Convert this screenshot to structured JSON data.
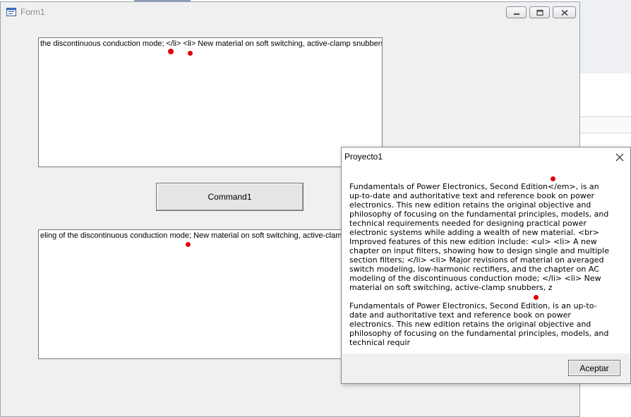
{
  "main_window": {
    "title": "Form1",
    "minimize_glyph": "minimize-icon",
    "maximize_glyph": "maximize-icon",
    "close_glyph": "close-icon"
  },
  "text1": {
    "value": "the discontinuous conduction mode; </li> <li> New material on soft switching, active-clamp snubbers, z"
  },
  "command1": {
    "label": "Command1"
  },
  "text2": {
    "value": "eling of the discontinuous conduction mode;   New material on soft switching, active-clamp snubbers, z"
  },
  "msgbox": {
    "title": "Proyecto1",
    "paragraph1": "Fundamentals of Power Electronics, Second Edition</em>, is an up-to-date and authoritative text and reference book on power electronics. This new edition retains the original objective and philosophy of focusing on the fundamental principles, models, and technical requirements needed for designing practical power electronic systems while adding a wealth of new material. <br> Improved features of this new edition include: <ul> <li> A new chapter on input filters, showing how to design single and multiple section filters; </li> <li> Major revisions of material on averaged switch modeling, low-harmonic rectifiers, and the chapter on AC modeling of the discontinuous conduction mode; </li> <li> New material on soft switching, active-clamp snubbers, z",
    "paragraph2": "Fundamentals of Power Electronics, Second Edition, is an up-to-date and authoritative text and reference book on power electronics. This new edition retains the original objective and philosophy of focusing on the fundamental principles, models, and technical requir",
    "ok_label": "Aceptar"
  },
  "colors": {
    "marker": "#e00000",
    "window_bg": "#f0f0f0",
    "title_text": "#8c8c8c"
  }
}
